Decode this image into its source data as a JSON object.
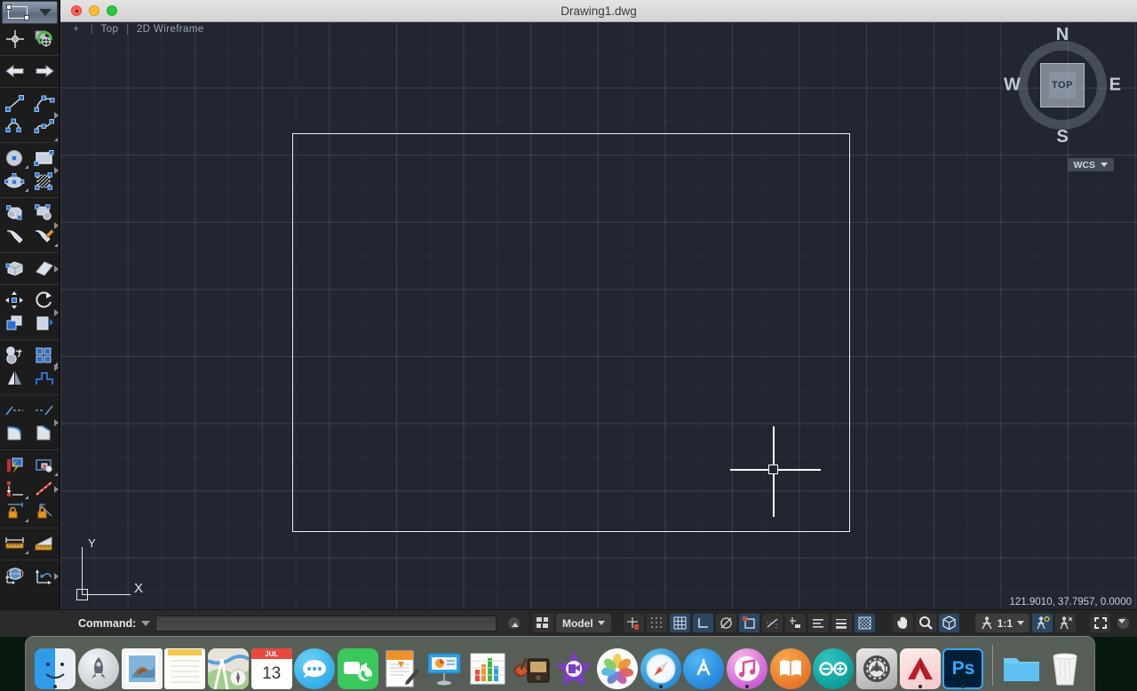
{
  "window": {
    "title": "Drawing1.dwg",
    "traffic_lights": [
      "close",
      "minimize",
      "zoom"
    ]
  },
  "viewport": {
    "plus": "+",
    "view_label": "Top",
    "visual_style": "2D Wireframe",
    "separator": "|"
  },
  "viewcube": {
    "north": "N",
    "south": "S",
    "east": "E",
    "west": "W",
    "face": "TOP",
    "ucs_label": "WCS"
  },
  "ucs_icon": {
    "y_label": "Y",
    "x_label": "X"
  },
  "coordinates": "121.9010, 37.7957, 0.0000",
  "command_line": {
    "label": "Command:",
    "value": "",
    "placeholder": ""
  },
  "status_bar": {
    "layout_button": "layout-grid-icon",
    "space_label": "Model",
    "scale_label": "1:1",
    "toggles": [
      {
        "name": "snap-mode",
        "icon": "snap-icon",
        "active": false
      },
      {
        "name": "grid-display",
        "icon": "grid-dots-icon",
        "active": false
      },
      {
        "name": "grid-mode",
        "icon": "grid-table-icon",
        "active": true
      },
      {
        "name": "ortho-mode",
        "icon": "ortho-icon",
        "active": true
      },
      {
        "name": "polar-tracking",
        "icon": "polar-icon",
        "active": false
      },
      {
        "name": "object-snap",
        "icon": "osnap-icon",
        "active": true
      },
      {
        "name": "object-snap-tracking",
        "icon": "otrack-icon",
        "active": false
      },
      {
        "name": "dynamic-ucs",
        "icon": "ducs-icon",
        "active": false
      },
      {
        "name": "dynamic-input",
        "icon": "dyn-input-icon",
        "active": false
      },
      {
        "name": "lineweight",
        "icon": "lineweight-icon",
        "active": false
      },
      {
        "name": "transparency",
        "icon": "transparency-icon",
        "active": true
      }
    ],
    "nav_tools": [
      {
        "name": "pan-tool",
        "icon": "hand-icon"
      },
      {
        "name": "zoom-tool",
        "icon": "magnifier-icon"
      },
      {
        "name": "orbit-tool",
        "icon": "cube-icon"
      }
    ],
    "annotation_tools": [
      {
        "name": "annotation-visibility",
        "icon": "annotation-person-icon",
        "active": true
      },
      {
        "name": "auto-scale",
        "icon": "autoscale-person-icon",
        "active": false
      }
    ],
    "fullscreen": "fullscreen-arrows-icon",
    "customize": "customize-chevron-icon"
  },
  "toolbar": {
    "header": {
      "icon": "rectangle-handles-icon",
      "caret": "chevron-down-icon"
    },
    "groups": [
      {
        "name": "workspace",
        "rows": [
          [
            {
              "name": "ucs-tool",
              "icon": "ucs-crosshair-icon"
            },
            {
              "name": "sync-view",
              "icon": "sync-green-icon"
            }
          ]
        ]
      },
      {
        "name": "undo-redo",
        "rows": [
          [
            {
              "name": "undo-button",
              "icon": "undo-arrow-icon"
            },
            {
              "name": "redo-button",
              "icon": "redo-arrow-icon"
            }
          ]
        ]
      },
      {
        "name": "draw-lines",
        "rows": [
          [
            {
              "name": "line-tool",
              "icon": "line-icon"
            },
            {
              "name": "polyline-tool",
              "icon": "polyline-icon"
            }
          ],
          [
            {
              "name": "arc-tool",
              "icon": "arc-icon"
            },
            {
              "name": "spline-tool",
              "icon": "spline-icon"
            }
          ]
        ]
      },
      {
        "name": "draw-shapes",
        "rows": [
          [
            {
              "name": "circle-tool",
              "icon": "circle-icon"
            },
            {
              "name": "rectangle-tool",
              "icon": "rectangle-icon"
            }
          ],
          [
            {
              "name": "ellipse-tool",
              "icon": "ellipse-icon"
            },
            {
              "name": "hatch-tool",
              "icon": "hatch-icon"
            }
          ]
        ]
      },
      {
        "name": "blocks-text",
        "rows": [
          [
            {
              "name": "insert-block-tool",
              "icon": "insert-block-icon"
            },
            {
              "name": "create-block-tool",
              "icon": "create-block-icon"
            }
          ],
          [
            {
              "name": "leader-tool",
              "icon": "leader-tag-icon"
            },
            {
              "name": "edit-attribute-tool",
              "icon": "attribute-edit-icon"
            }
          ]
        ]
      },
      {
        "name": "solids",
        "rows": [
          [
            {
              "name": "box-solid-tool",
              "icon": "box-solid-icon"
            },
            {
              "name": "eraser-tool",
              "icon": "eraser-icon"
            }
          ]
        ]
      },
      {
        "name": "modify-move",
        "rows": [
          [
            {
              "name": "move-tool",
              "icon": "move-arrows-icon"
            },
            {
              "name": "rotate-tool",
              "icon": "rotate-arrow-icon"
            }
          ],
          [
            {
              "name": "copy-tool",
              "icon": "copy-icon"
            },
            {
              "name": "scale-tool",
              "icon": "scale-icon"
            }
          ]
        ]
      },
      {
        "name": "modify-array",
        "rows": [
          [
            {
              "name": "offset-tool",
              "icon": "offset-circles-icon"
            },
            {
              "name": "array-tool",
              "icon": "array-grid-icon"
            }
          ],
          [
            {
              "name": "mirror-tool",
              "icon": "mirror-icon"
            },
            {
              "name": "stretch-tool",
              "icon": "stretch-icon"
            }
          ]
        ]
      },
      {
        "name": "modify-trim",
        "rows": [
          [
            {
              "name": "trim-tool",
              "icon": "trim-icon"
            },
            {
              "name": "extend-tool",
              "icon": "extend-icon"
            }
          ],
          [
            {
              "name": "fillet-tool",
              "icon": "fillet-icon"
            },
            {
              "name": "chamfer-tool",
              "icon": "chamfer-icon"
            }
          ]
        ]
      },
      {
        "name": "layers-properties",
        "rows": [
          [
            {
              "name": "layer-properties-tool",
              "icon": "layer-flash-icon"
            },
            {
              "name": "layer-state-tool",
              "icon": "layer-state-icon"
            }
          ],
          [
            {
              "name": "linetype-tool",
              "icon": "linetype-icon"
            },
            {
              "name": "color-tool",
              "icon": "color-line-icon"
            }
          ],
          [
            {
              "name": "lock-layer-tool",
              "icon": "lock-dimension-icon"
            },
            {
              "name": "lock-angle-tool",
              "icon": "lock-angle-icon"
            }
          ]
        ]
      },
      {
        "name": "annotate",
        "rows": [
          [
            {
              "name": "dimension-tool",
              "icon": "dimension-ruler-icon"
            },
            {
              "name": "measure-tool",
              "icon": "measure-ramp-icon"
            }
          ]
        ]
      },
      {
        "name": "view-tools",
        "rows": [
          [
            {
              "name": "3d-view-tool",
              "icon": "globe-axis-icon"
            },
            {
              "name": "ucs-restore-tool",
              "icon": "ucs-undo-icon"
            }
          ]
        ]
      }
    ]
  },
  "dock": {
    "items": [
      {
        "name": "finder",
        "label": "Finder",
        "running": true
      },
      {
        "name": "launchpad",
        "label": "Launchpad",
        "running": false
      },
      {
        "name": "mail",
        "label": "Mail",
        "running": false
      },
      {
        "name": "notes",
        "label": "Notes",
        "running": false
      },
      {
        "name": "maps",
        "label": "Maps",
        "running": false
      },
      {
        "name": "calendar",
        "label": "Calendar",
        "running": false,
        "month": "JUL",
        "day": "13"
      },
      {
        "name": "messages",
        "label": "Messages",
        "running": false
      },
      {
        "name": "facetime",
        "label": "FaceTime",
        "running": false
      },
      {
        "name": "pages",
        "label": "Pages",
        "running": false
      },
      {
        "name": "keynote",
        "label": "Keynote",
        "running": false
      },
      {
        "name": "numbers",
        "label": "Numbers",
        "running": false
      },
      {
        "name": "garageband",
        "label": "GarageBand",
        "running": false
      },
      {
        "name": "imovie",
        "label": "iMovie",
        "running": false
      },
      {
        "name": "photos",
        "label": "Photos",
        "running": false
      },
      {
        "name": "safari",
        "label": "Safari",
        "running": true
      },
      {
        "name": "app-store",
        "label": "App Store",
        "running": false
      },
      {
        "name": "itunes",
        "label": "iTunes",
        "running": true
      },
      {
        "name": "ibooks",
        "label": "iBooks",
        "running": false
      },
      {
        "name": "arduino",
        "label": "Arduino",
        "running": false
      },
      {
        "name": "system-preferences",
        "label": "System Preferences",
        "running": false
      },
      {
        "name": "autocad",
        "label": "AutoCAD",
        "running": true
      },
      {
        "name": "photoshop",
        "label": "Photoshop",
        "running": true,
        "badge": "Ps"
      }
    ],
    "trailing": [
      {
        "name": "downloads-folder",
        "label": "Downloads"
      },
      {
        "name": "trash",
        "label": "Trash"
      }
    ]
  }
}
